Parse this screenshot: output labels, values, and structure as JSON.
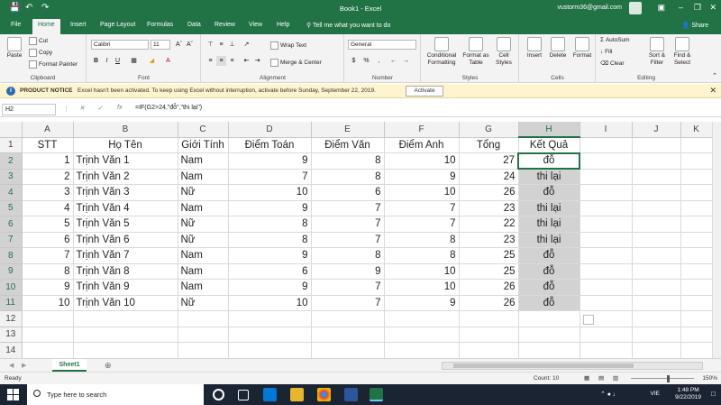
{
  "window": {
    "title": "Book1 - Excel",
    "user": "vustorm36@gmail.com"
  },
  "tabs": [
    "File",
    "Home",
    "Insert",
    "Page Layout",
    "Formulas",
    "Data",
    "Review",
    "View",
    "Help"
  ],
  "tell_me": "Tell me what you want to do",
  "share": "Share",
  "ribbon": {
    "paste": "Paste",
    "cut": "Cut",
    "copy": "Copy",
    "format_painter": "Format Painter",
    "clipboard": "Clipboard",
    "font_name": "Calibri",
    "font_size": "11",
    "font_group": "Font",
    "wrap_text": "Wrap Text",
    "merge_center": "Merge & Center",
    "alignment": "Alignment",
    "number_format": "General",
    "number": "Number",
    "conditional_formatting": "Conditional Formatting",
    "format_as_table": "Format as Table",
    "cell_styles": "Cell Styles",
    "styles": "Styles",
    "insert": "Insert",
    "delete": "Delete",
    "format": "Format",
    "cells": "Cells",
    "autosum": "AutoSum",
    "fill": "Fill",
    "clear": "Clear",
    "sort_filter": "Sort & Filter",
    "find_select": "Find & Select",
    "editing": "Editing"
  },
  "notice": {
    "title": "PRODUCT NOTICE",
    "message": "Excel hasn't been activated. To keep using Excel without interruption, activate before Sunday, September 22, 2019.",
    "button": "Activate"
  },
  "formula_bar": {
    "name_box": "H2",
    "formula": "=IF(G2>24,\"đỗ\",\"thi lại\")"
  },
  "columns": [
    "A",
    "B",
    "C",
    "D",
    "E",
    "F",
    "G",
    "H",
    "I",
    "J",
    "K"
  ],
  "headers": [
    "STT",
    "Họ Tên",
    "Giới Tính",
    "Điểm Toán",
    "Điểm Văn",
    "Điểm Anh",
    "Tổng",
    "Kết Quả"
  ],
  "rows": [
    {
      "stt": "1",
      "name": "Trịnh Văn 1",
      "gender": "Nam",
      "math": "9",
      "lit": "8",
      "eng": "10",
      "total": "27",
      "result": "đỗ"
    },
    {
      "stt": "2",
      "name": "Trịnh Văn 2",
      "gender": "Nam",
      "math": "7",
      "lit": "8",
      "eng": "9",
      "total": "24",
      "result": "thi lại"
    },
    {
      "stt": "3",
      "name": "Trịnh Văn 3",
      "gender": "Nữ",
      "math": "10",
      "lit": "6",
      "eng": "10",
      "total": "26",
      "result": "đỗ"
    },
    {
      "stt": "4",
      "name": "Trịnh Văn 4",
      "gender": "Nam",
      "math": "9",
      "lit": "7",
      "eng": "7",
      "total": "23",
      "result": "thi lại"
    },
    {
      "stt": "5",
      "name": "Trịnh Văn 5",
      "gender": "Nữ",
      "math": "8",
      "lit": "7",
      "eng": "7",
      "total": "22",
      "result": "thi lại"
    },
    {
      "stt": "6",
      "name": "Trịnh Văn 6",
      "gender": "Nữ",
      "math": "8",
      "lit": "7",
      "eng": "8",
      "total": "23",
      "result": "thi lại"
    },
    {
      "stt": "7",
      "name": "Trịnh Văn 7",
      "gender": "Nam",
      "math": "9",
      "lit": "8",
      "eng": "8",
      "total": "25",
      "result": "đỗ"
    },
    {
      "stt": "8",
      "name": "Trịnh Văn 8",
      "gender": "Nam",
      "math": "6",
      "lit": "9",
      "eng": "10",
      "total": "25",
      "result": "đỗ"
    },
    {
      "stt": "9",
      "name": "Trịnh Văn 9",
      "gender": "Nam",
      "math": "9",
      "lit": "7",
      "eng": "10",
      "total": "26",
      "result": "đỗ"
    },
    {
      "stt": "10",
      "name": "Trịnh Văn 10",
      "gender": "Nữ",
      "math": "10",
      "lit": "7",
      "eng": "9",
      "total": "26",
      "result": "đỗ"
    }
  ],
  "row_numbers": [
    "1",
    "2",
    "3",
    "4",
    "5",
    "6",
    "7",
    "8",
    "9",
    "10",
    "11",
    "12",
    "13",
    "14"
  ],
  "sheet": {
    "name": "Sheet1"
  },
  "status": {
    "ready": "Ready",
    "count": "Count: 10",
    "zoom": "150%"
  },
  "taskbar": {
    "search": "Type here to search",
    "lang": "VIE",
    "time": "1:48 PM",
    "date": "9/22/2019"
  },
  "colors": {
    "excel_green": "#217346",
    "selection": "#d2d2d2"
  }
}
